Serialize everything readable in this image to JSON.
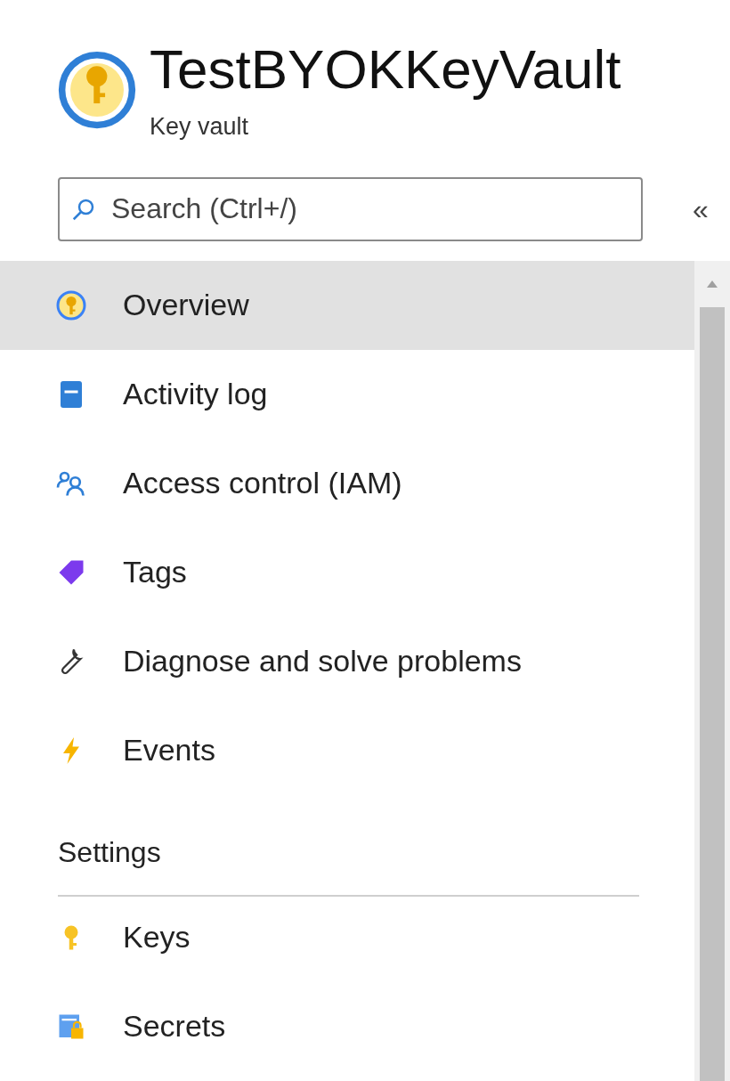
{
  "header": {
    "title": "TestBYOKKeyVault",
    "subtitle": "Key vault"
  },
  "search": {
    "placeholder": "Search (Ctrl+/)"
  },
  "collapse_button": "«",
  "menu": [
    {
      "label": "Overview",
      "selected": true
    },
    {
      "label": "Activity log",
      "selected": false
    },
    {
      "label": "Access control (IAM)",
      "selected": false
    },
    {
      "label": "Tags",
      "selected": false
    },
    {
      "label": "Diagnose and solve problems",
      "selected": false
    },
    {
      "label": "Events",
      "selected": false
    }
  ],
  "sections": [
    {
      "heading": "Settings",
      "items": [
        {
          "label": "Keys",
          "selected": false
        },
        {
          "label": "Secrets",
          "selected": false
        }
      ]
    }
  ]
}
